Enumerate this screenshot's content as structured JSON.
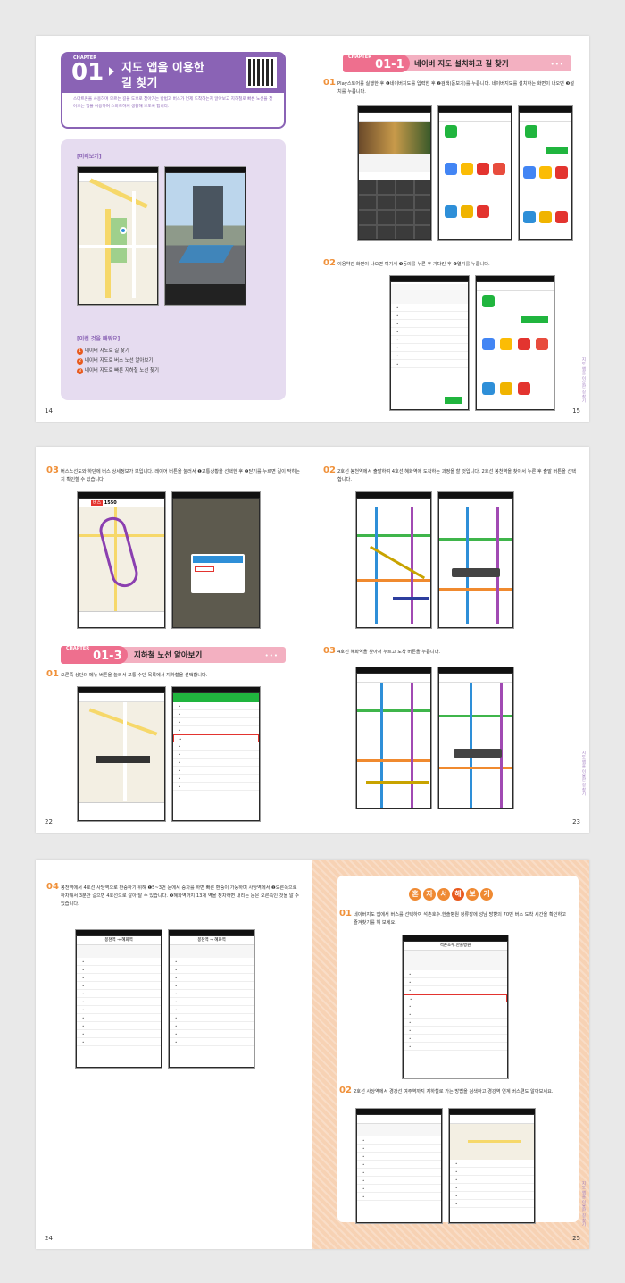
{
  "spread1": {
    "left_page": {
      "chapter_label": "CHAPTER",
      "chapter_num": "01",
      "title_line1": "지도 앱을 이용한",
      "title_line2": "길 찾기",
      "intro": "스마트폰을 사용하며 모르는 길을 도보로 찾아가는 방법과 버스가 언제 도착하는지 알아보고 지하철로 빠른 노선을 찾아보는 앱을 이용하여 스마트하게 생활해 보도록 합니다.",
      "preview_label": "[미리보기]",
      "learn_label": "[이런 것을 배워요]",
      "learn_items": [
        "네이버 지도로 길 찾기",
        "네이버 지도로 버스 노선 알아보기",
        "네이버 지도로 빠른 지하철 노선 찾기"
      ],
      "page_number": "14"
    },
    "right_page": {
      "chapter_label": "CHAPTER",
      "chapter_num": "01-1",
      "title": "네이버 지도 설치하고 길 찾기",
      "step1_num": "01",
      "step1_text": "Play스토어를 실행한 후 ❶네이버지도를 입력한 후 ❷검색(돋보기)를 누릅니다. 네이버지도를 설치하는 화면이 나오면 ❸설치를 누릅니다.",
      "step2_num": "02",
      "step2_text": "이용약관 화면이 나오면 여기서 ❹동의를 누른 후 기다린 후 ❺열기를 누릅니다.",
      "side_text": "지도 앱을 이용한 길 찾기",
      "page_number": "15"
    }
  },
  "spread2": {
    "left_page": {
      "step3_num": "03",
      "step3_text": "버스노선도와 하단에 버스 상세정보가 보입니다. 레이어 버튼을 눌러서 ❶교통상황을 선택한 후 ❷닫기를 누르면 길이 막히는지 확인할 수 있습니다.",
      "chapter_label": "CHAPTER",
      "chapter_num": "01-3",
      "chapter_title": "지하철 노선 알아보기",
      "step1_num": "01",
      "step1_text": "오른쪽 상단의 메뉴 버튼을 눌러서 교통 수단 목록에서 지하철을 선택합니다.",
      "bus_number": "1550",
      "page_number": "22"
    },
    "right_page": {
      "step2_num": "02",
      "step2_text": "2호선 봉천역에서 출발하여 4호선 혜화역에 도착하는 과정을 할 것입니다. 2호선 봉천역을 찾아서 누른 후 출발 버튼을 선택합니다.",
      "step3_num": "03",
      "step3_text": "4호선 혜화역을 찾아서 누르고 도착 버튼을 누릅니다.",
      "side_text": "지도 앱을 이용한 길 찾기",
      "page_number": "23"
    }
  },
  "spread3": {
    "left_page": {
      "step4_num": "04",
      "step4_text": "봉천역에서 4호선 사당역으로 환승하기 위해 ❶5~3번 문에서 승차를 하면 빠른 환승이 가능하며 사당역에서 ❷오른쪽으로 하차해서 3분만 걸으면 4호선으로 갈아 탈 수 있습니다. ❸혜화역까지 13개 역을 정차하면 내리는 문은 오른쪽인 것을 알 수 있습니다.",
      "route_title": "봉천역 → 혜화역",
      "page_number": "24"
    },
    "right_page": {
      "self_title": [
        "혼",
        "자",
        "서",
        "해",
        "보",
        "기"
      ],
      "step1_num": "01",
      "step1_text": "네이버지도 앱에서 버스를 선택하여 석촌호수.한솔병원 정류장에 성남 방향의 70번 버스 도착 시간을 확인하고 즐겨찾기를 해 보세요.",
      "step2_num": "02",
      "step2_text": "2호선 사당역에서 경강선 여주역까지 지하철로 가는 방법을 검색하고 경강역 연계 버스편도 알아보세요.",
      "stop_name": "석촌호수.한솔병원",
      "side_text": "지도 앱을 이용한 길 찾기",
      "page_number": "25"
    }
  },
  "colors": {
    "purple": "#8a63b5",
    "lavender": "#e6dcf0",
    "pink": "#ee6f8e",
    "orange": "#f0913a",
    "peach": "#f7d2b4"
  }
}
